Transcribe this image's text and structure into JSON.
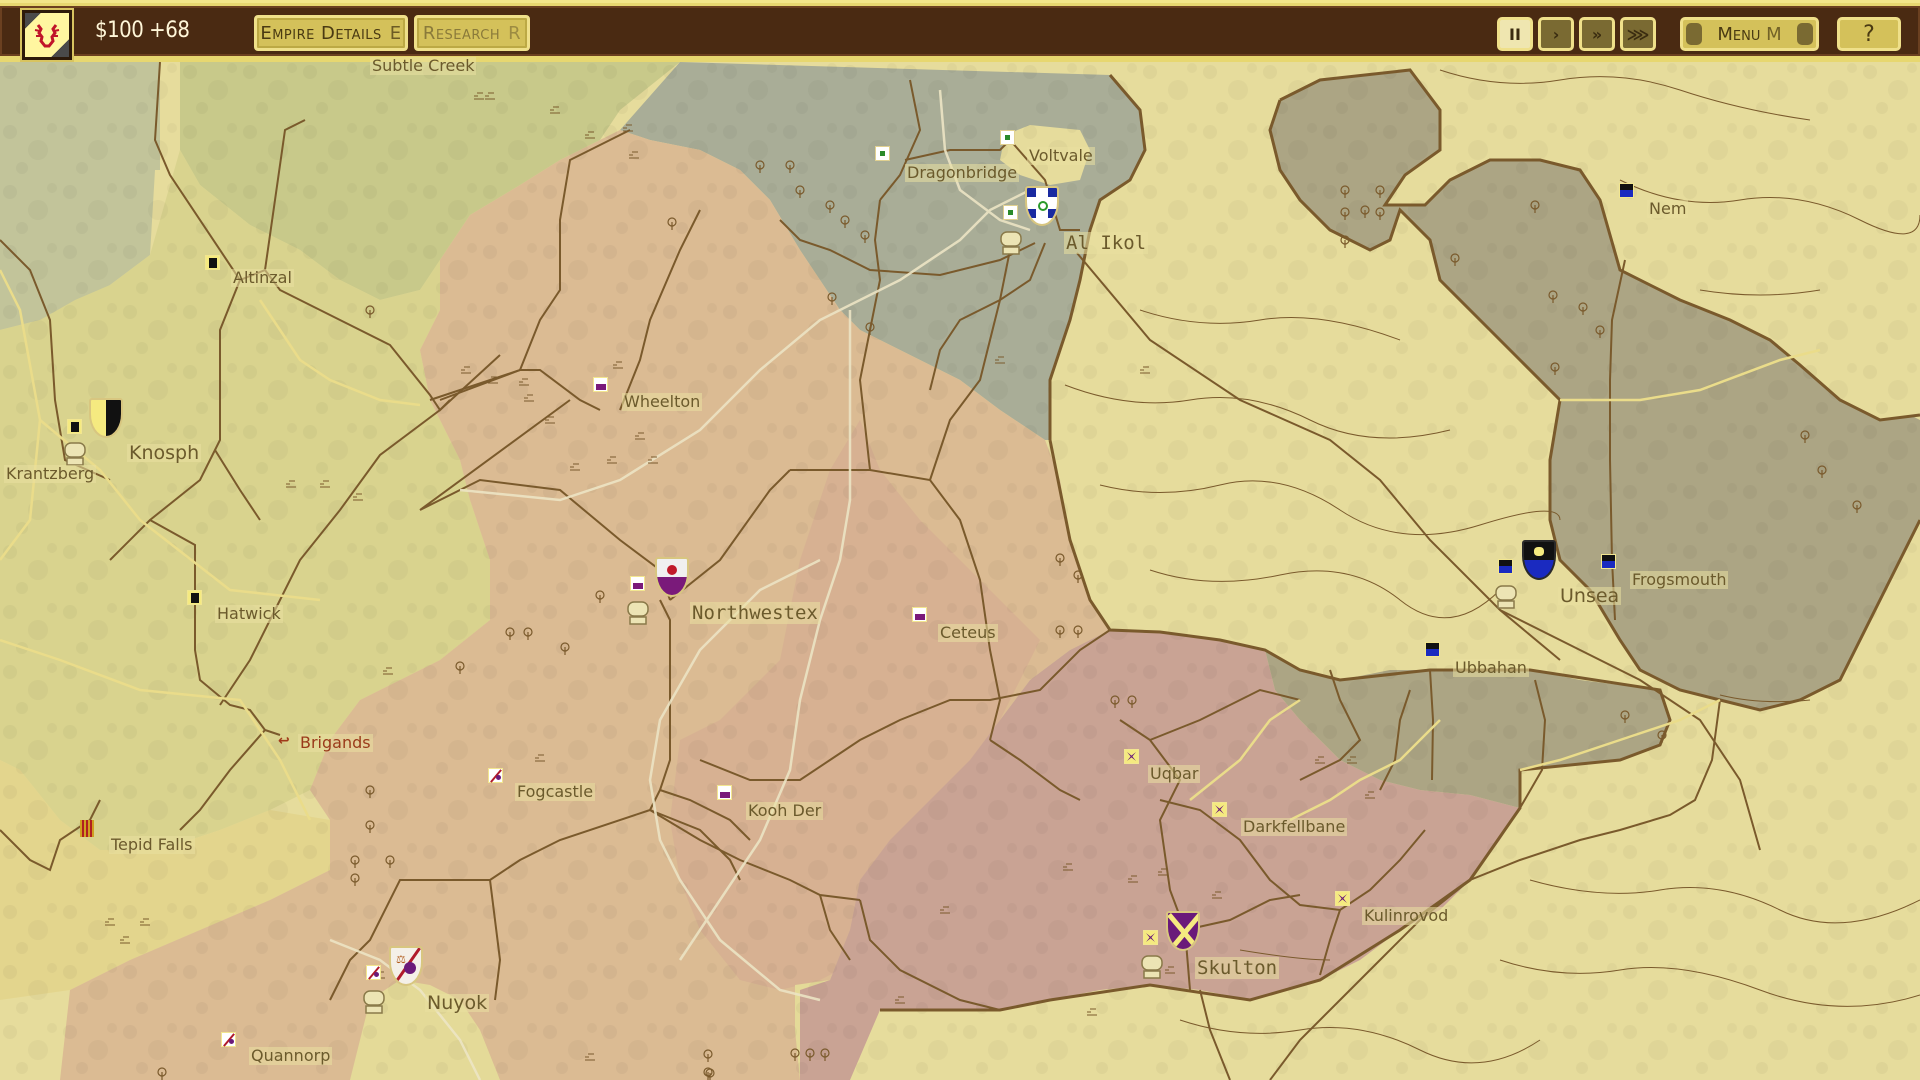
{
  "topbar": {
    "treasury": "$100 +68",
    "empire_details": {
      "label": "Empire Details",
      "hotkey": "E"
    },
    "research": {
      "label": "Research",
      "hotkey": "R"
    },
    "speed_controls": [
      {
        "name": "pause",
        "glyph": "II",
        "active": true
      },
      {
        "name": "play",
        "glyph": "›",
        "active": false
      },
      {
        "name": "fast",
        "glyph": "»",
        "active": false
      },
      {
        "name": "fastest",
        "glyph": "⋙",
        "active": false
      }
    ],
    "menu": {
      "label": "Menu",
      "hotkey": "M"
    },
    "help": {
      "label": "?"
    }
  },
  "colors": {
    "player_emblem": "#c0142a",
    "terrain_desert": "#e6dc9c",
    "faction_orange": "#dbbb93",
    "faction_pink": "#c9a394",
    "faction_slate": "#a9ad97",
    "faction_olive": "#aca584",
    "faction_green": "#c8c98a",
    "faction_yellow": "#d9d38e",
    "border": "#7a5a2c"
  },
  "factions": [
    {
      "id": "yellow",
      "name": "Knosph realm",
      "coat": "black-on-yellow"
    },
    {
      "id": "slate",
      "name": "Al Ikol realm",
      "coat": "blue-white-green"
    },
    {
      "id": "orange",
      "name": "Northwestex realm",
      "coat": "red-purple-white"
    },
    {
      "id": "nuyok",
      "name": "Nuyok realm",
      "coat": "scales-purple-white"
    },
    {
      "id": "pink",
      "name": "Skulton realm",
      "coat": "yellow-saltire-purple"
    },
    {
      "id": "olive",
      "name": "Unsea realm",
      "coat": "black-blue-yellow"
    },
    {
      "id": "tepid",
      "name": "Tepid Falls",
      "coat": "red-yellow-pales"
    }
  ],
  "places": {
    "subtle_creek": "Subtle Creek",
    "altinzal": "Altinzal",
    "knosph": "Knosph",
    "krantzberg": "Krantzberg",
    "hatwick": "Hatwick",
    "brigands": "Brigands",
    "tepid_falls": "Tepid Falls",
    "wheelton": "Wheelton",
    "northwestex": "Northwestex",
    "ceteus": "Ceteus",
    "fogcastle": "Fogcastle",
    "kooh_der": "Kooh Der",
    "nuyok": "Nuyok",
    "quannorp": "Quannorp",
    "dragonbridge": "Dragonbridge",
    "voltvale": "Voltvale",
    "al_ikol": "Al Ikol",
    "nem": "Nem",
    "unsea": "Unsea",
    "frogsmouth": "Frogsmouth",
    "ubbahan": "Ubbahan",
    "uqbar": "Uqbar",
    "darkfellbane": "Darkfellbane",
    "kulinrovod": "Kulinrovod",
    "skulton": "Skulton"
  }
}
